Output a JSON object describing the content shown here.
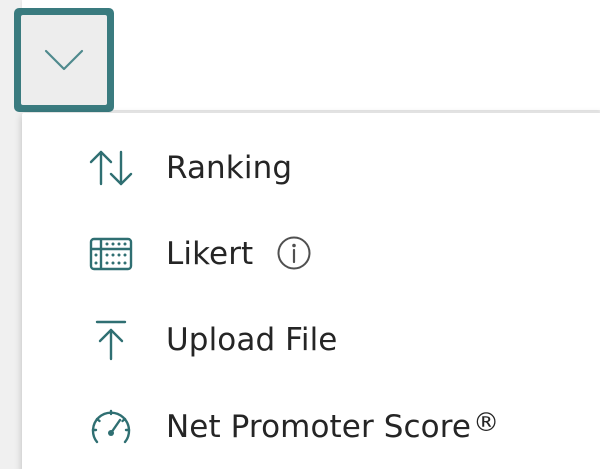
{
  "menu": {
    "items": [
      {
        "label": "Ranking",
        "icon": "sort-arrows-icon"
      },
      {
        "label": "Likert",
        "icon": "likert-grid-icon",
        "has_info": true,
        "info_icon": "info-icon"
      },
      {
        "label": "Upload File",
        "icon": "upload-icon"
      },
      {
        "label": "Net Promoter Score",
        "suffix": "®",
        "icon": "gauge-icon"
      }
    ]
  },
  "toggle": {
    "icon": "chevron-down-icon"
  },
  "colors": {
    "accent": "#3a7b7f",
    "text": "#252525",
    "icon_stroke": "#2f6f72"
  }
}
